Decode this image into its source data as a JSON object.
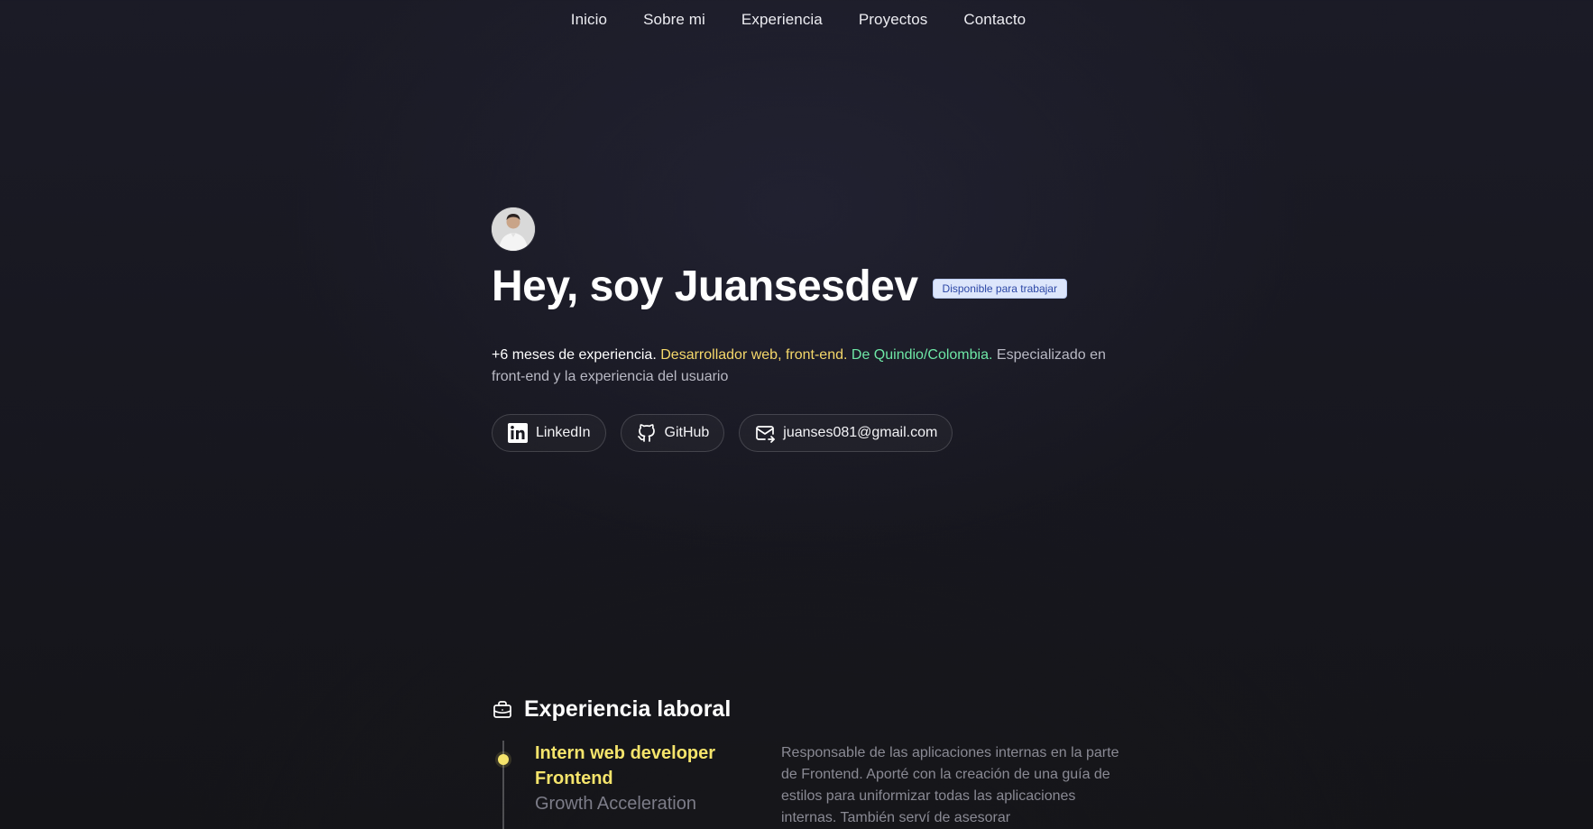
{
  "nav": {
    "items": [
      {
        "label": "Inicio"
      },
      {
        "label": "Sobre mi"
      },
      {
        "label": "Experiencia"
      },
      {
        "label": "Proyectos"
      },
      {
        "label": "Contacto"
      }
    ]
  },
  "hero": {
    "title": "Hey, soy Juansesdev",
    "badge": "Disponible para trabajar",
    "desc_exp": "+6 meses de experiencia.",
    "desc_role": "Desarrollador web, front-end.",
    "desc_loc": "De Quindio/Colombia.",
    "desc_rest": "Especializado en front-end y la experiencia del usuario",
    "links": {
      "linkedin": "LinkedIn",
      "github": "GitHub",
      "email": "juanses081@gmail.com"
    }
  },
  "experience": {
    "heading": "Experiencia laboral",
    "jobs": [
      {
        "title": "Intern web developer Frontend",
        "company": "Growth Acceleration",
        "description": "Responsable de las aplicaciones internas en la parte de Frontend. Aporté con la creación de una guía de estilos para uniformizar todas las aplicaciones internas. También serví de asesorar"
      }
    ]
  },
  "colors": {
    "accent_yellow": "#f5d86a",
    "accent_green": "#6ee7a6",
    "badge_bg": "#dde6fb",
    "badge_text": "#2c47a6",
    "timeline_dot": "#f5e46b"
  },
  "icons": {
    "linkedin": "linkedin-icon",
    "github": "github-icon",
    "email": "mail-icon",
    "experience": "briefcase-icon"
  }
}
